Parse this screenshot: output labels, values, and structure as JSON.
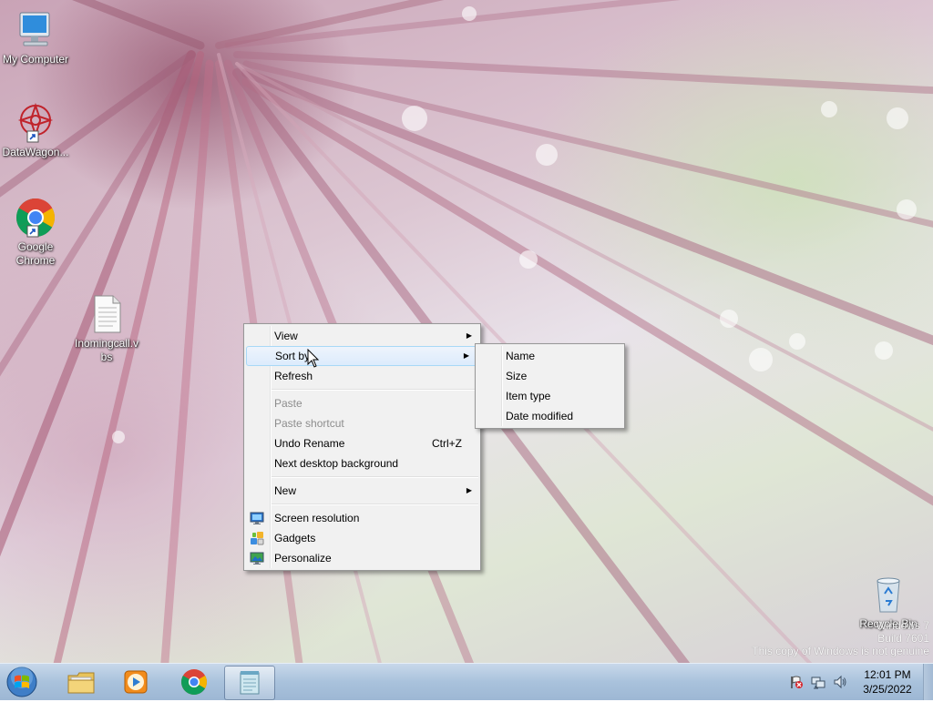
{
  "desktop_icons": [
    {
      "label": "My Computer",
      "icon": "computer-icon"
    },
    {
      "label": "DataWagon...",
      "icon": "datawagon-shortcut-icon"
    },
    {
      "label": "Google Chrome",
      "icon": "chrome-shortcut-icon"
    },
    {
      "label": "Inomingcall.vbs",
      "icon": "vbs-file-icon"
    },
    {
      "label": "Recycle Bin",
      "icon": "recycle-bin-icon"
    }
  ],
  "context_menu": {
    "items": [
      {
        "label": "View",
        "submenu": true
      },
      {
        "label": "Sort by",
        "submenu": true,
        "highlighted": true
      },
      {
        "label": "Refresh"
      },
      {
        "label": "Paste",
        "disabled": true
      },
      {
        "label": "Paste shortcut",
        "disabled": true
      },
      {
        "label": "Undo Rename",
        "shortcut": "Ctrl+Z"
      },
      {
        "label": "Next desktop background"
      },
      {
        "label": "New",
        "submenu": true
      },
      {
        "label": "Screen resolution",
        "icon": "screen-resolution-icon"
      },
      {
        "label": "Gadgets",
        "icon": "gadgets-icon"
      },
      {
        "label": "Personalize",
        "icon": "personalize-icon"
      }
    ]
  },
  "sort_submenu": {
    "items": [
      "Name",
      "Size",
      "Item type",
      "Date modified"
    ]
  },
  "watermark": {
    "line1": "Windows 7",
    "line2": "Build 7601",
    "line3": "This copy of Windows is not genuine"
  },
  "taskbar": {
    "apps": [
      {
        "name": "Windows Explorer",
        "icon": "explorer-icon"
      },
      {
        "name": "Windows Media Player",
        "icon": "media-player-icon"
      },
      {
        "name": "Google Chrome",
        "icon": "chrome-icon"
      },
      {
        "name": "Notepad",
        "icon": "notepad-icon",
        "active": true
      }
    ]
  },
  "tray": {
    "time": "12:01 PM",
    "date": "3/25/2022"
  },
  "colors": {
    "menu_bg": "#f1f1f1",
    "highlight_border": "#a8d8f7",
    "taskbar": "#a9c2dc"
  }
}
